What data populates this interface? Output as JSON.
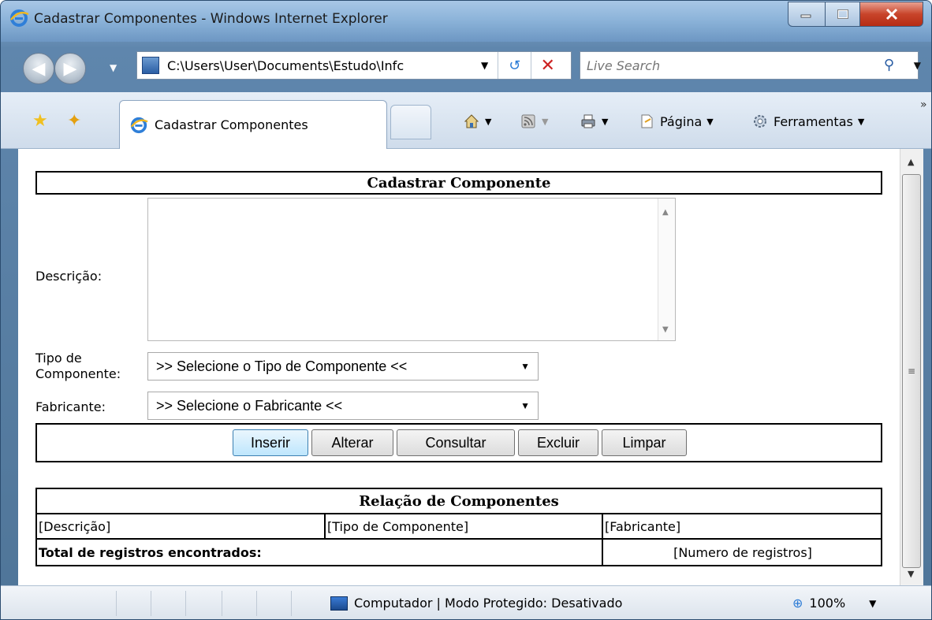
{
  "window": {
    "title": "Cadastrar Componentes - Windows Internet Explorer"
  },
  "address_bar": {
    "url": "C:\\Users\\User\\Documents\\Estudo\\Infc"
  },
  "search": {
    "placeholder": "Live Search"
  },
  "tabs": [
    {
      "label": "Cadastrar Componentes",
      "active": true
    }
  ],
  "command_bar": {
    "page_label": "Página",
    "tools_label": "Ferramentas"
  },
  "form": {
    "title": "Cadastrar Componente",
    "descricao_label": "Descrição:",
    "descricao_value": "",
    "tipo_label": "Tipo de Componente:",
    "tipo_selected": ">> Selecione o Tipo de Componente <<",
    "fabricante_label": "Fabricante:",
    "fabricante_selected": ">> Selecione o Fabricante <<",
    "buttons": {
      "inserir": "Inserir",
      "alterar": "Alterar",
      "consultar": "Consultar",
      "excluir": "Excluir",
      "limpar": "Limpar"
    }
  },
  "list": {
    "title": "Relação de Componentes",
    "columns": [
      "[Descrição]",
      "[Tipo de Componente]",
      "[Fabricante]"
    ],
    "total_label": "Total de registros encontrados:",
    "total_value": "[Numero de registros]"
  },
  "status_bar": {
    "zone": "Computador | Modo Protegido: Desativado",
    "zoom": "100%"
  },
  "icons": {
    "back": "back-arrow-icon",
    "forward": "forward-arrow-icon",
    "refresh": "refresh-icon",
    "stop": "stop-icon",
    "search": "search-icon",
    "favorites": "favorites-star-icon",
    "add_favorites": "add-favorites-icon",
    "home": "home-icon",
    "feeds": "feeds-icon",
    "print": "print-icon",
    "page": "page-icon",
    "tools": "gear-icon",
    "zoom": "zoom-icon"
  }
}
